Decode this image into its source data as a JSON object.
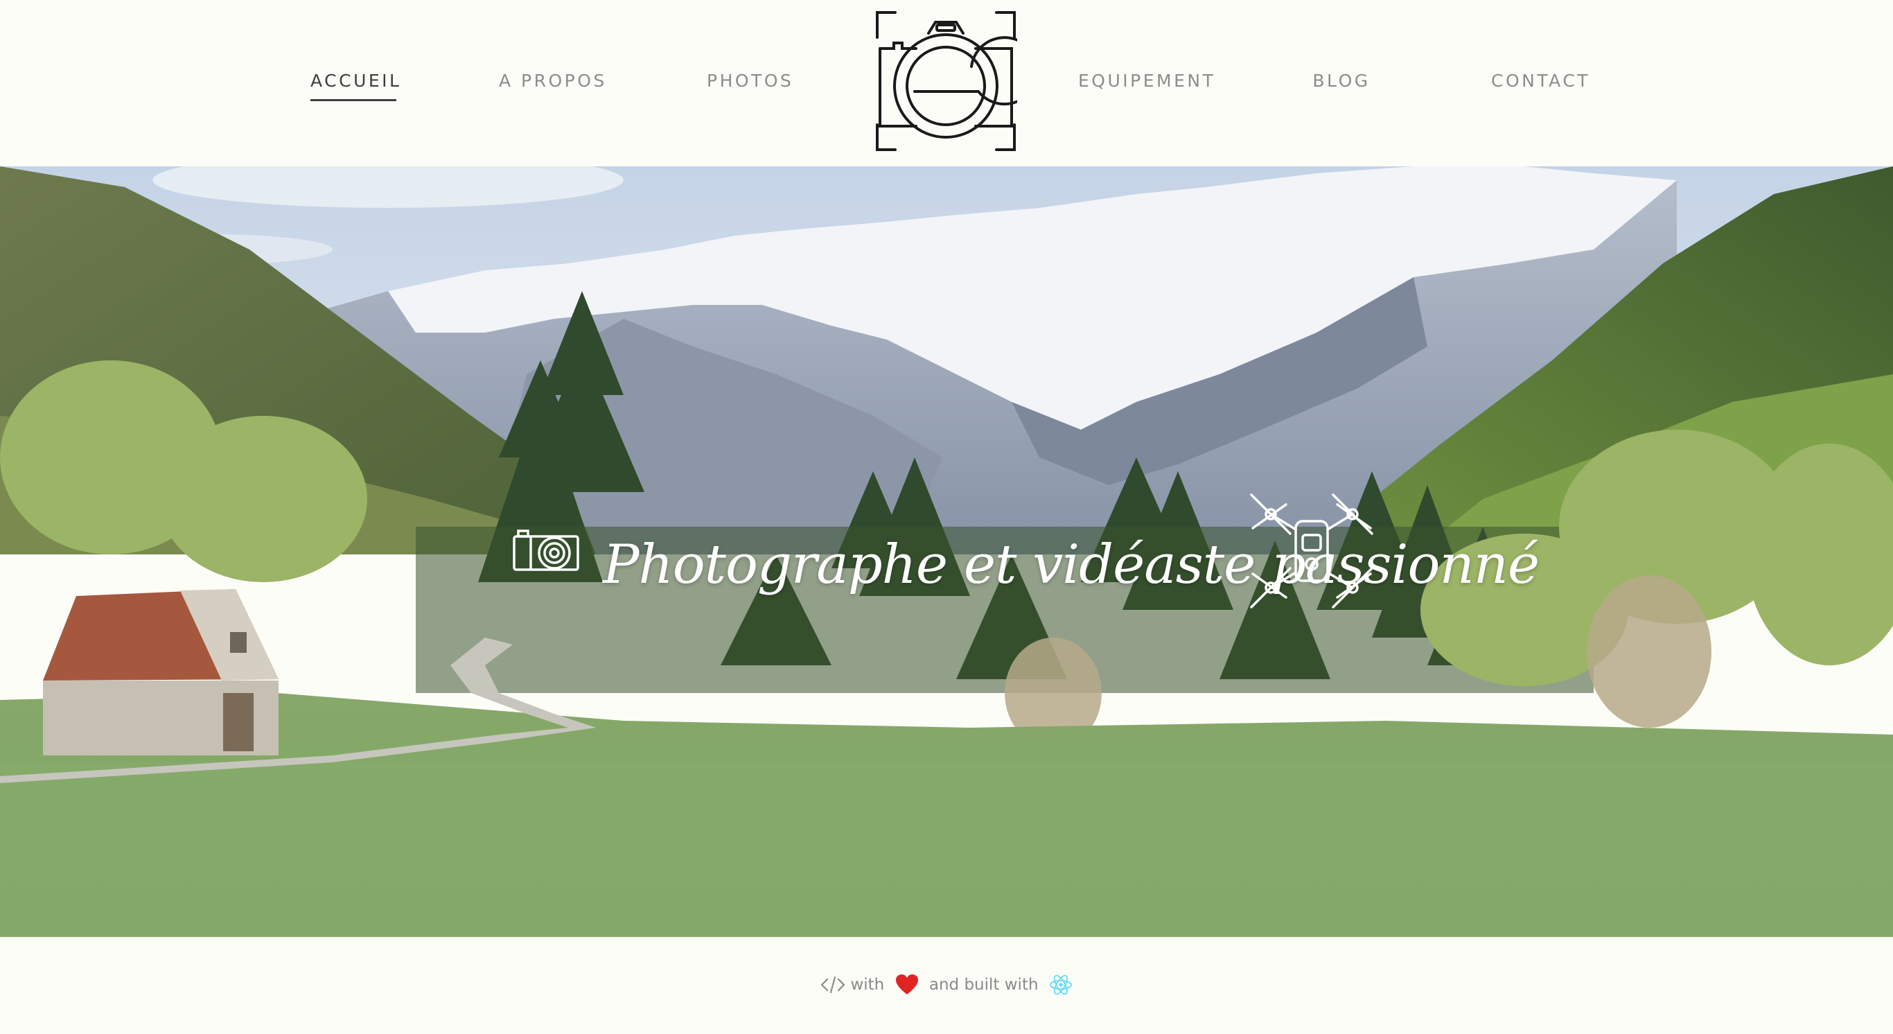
{
  "nav": {
    "items": [
      {
        "label": "ACCUEIL",
        "active": true
      },
      {
        "label": "A PROPOS",
        "active": false
      },
      {
        "label": "PHOTOS",
        "active": false
      },
      {
        "label": "EQUIPEMENT",
        "active": false
      },
      {
        "label": "BLOG",
        "active": false
      },
      {
        "label": "CONTACT",
        "active": false
      }
    ],
    "logo_icon": "camera-viewfinder-logo-icon"
  },
  "hero": {
    "tagline": "Photographe et vidéaste passionné",
    "left_icon": "camera-icon",
    "right_icon": "drone-icon",
    "background": "mountain-valley-photo"
  },
  "footer": {
    "code_icon": "code-icon",
    "with_text": "with",
    "heart_icon": "heart-icon",
    "built_text": "and built with",
    "react_icon": "react-icon"
  },
  "colors": {
    "background": "#fdfdf8",
    "nav_text": "#8c8c8c",
    "nav_active": "#3d3d3d",
    "heart": "#e02424",
    "react": "#61dafb"
  }
}
